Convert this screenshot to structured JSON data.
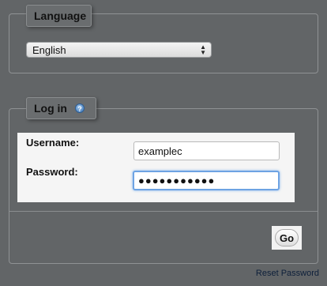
{
  "language_section": {
    "legend": "Language",
    "selected_language": "English"
  },
  "login_section": {
    "legend": "Log in",
    "help_icon": "help-icon",
    "username_label": "Username:",
    "username_value": "examplec",
    "password_label": "Password:",
    "password_value": "●●●●●●●●●●●",
    "go_label": "Go"
  },
  "reset_password_label": "Reset Password",
  "colors": {
    "background": "#626567",
    "focus_ring": "#6ea3e3",
    "login_panel": "#f5f5f5"
  }
}
